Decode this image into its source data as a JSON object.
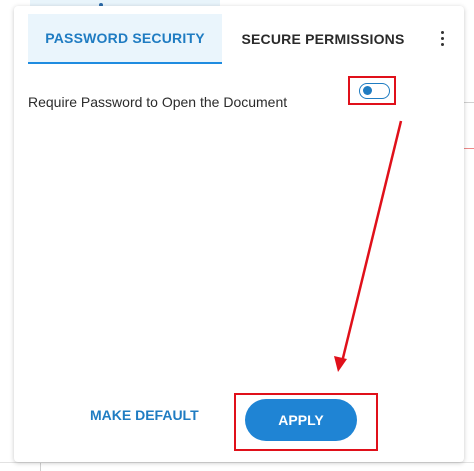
{
  "tabs": [
    {
      "label": "PASSWORD SECURITY",
      "active": true
    },
    {
      "label": "SECURE PERMISSIONS",
      "active": false
    }
  ],
  "more_menu_icon": "kebab-vertical-icon",
  "settings": {
    "require_password_label": "Require Password to Open the Document",
    "require_password_enabled": false
  },
  "actions": {
    "make_default_label": "MAKE DEFAULT",
    "apply_label": "APPLY"
  },
  "colors": {
    "accent": "#1f84d4",
    "active_tab_bg": "#eaf5fc",
    "annotation_red": "#e0101a"
  }
}
